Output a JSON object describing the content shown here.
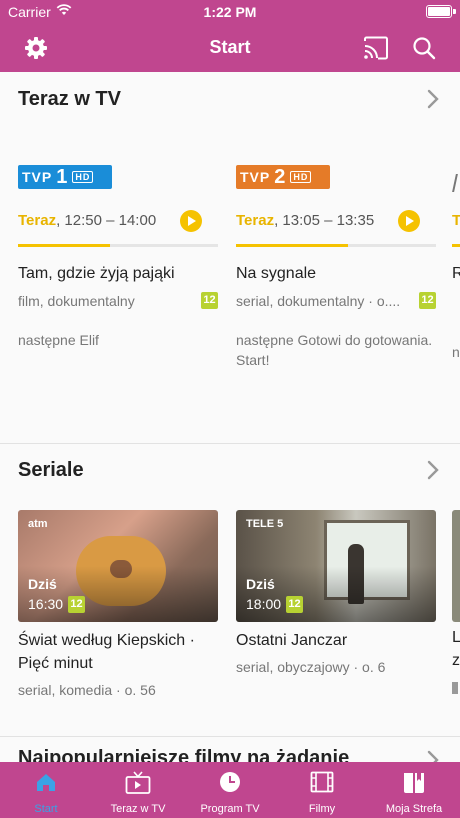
{
  "status": {
    "carrier": "Carrier",
    "time": "1:22 PM"
  },
  "header": {
    "title": "Start"
  },
  "now_on_tv": {
    "title": "Teraz w TV",
    "items": [
      {
        "channel": "TVP",
        "channel_number": "1",
        "hd": "HD",
        "now_label": "Teraz",
        "time": ", 12:50 – 14:00",
        "progress": 0.46,
        "show": "Tam, gdzie żyją pająki",
        "genre": "film, dokumentalny",
        "age": "12",
        "next": "następne Elif"
      },
      {
        "channel": "TVP",
        "channel_number": "2",
        "hd": "HD",
        "now_label": "Teraz",
        "time": ", 13:05 – 13:35",
        "progress": 0.56,
        "show": "Na sygnale",
        "genre": "serial, dokumentalny · o....",
        "age": "12",
        "next": "następne Gotowi do gotowania. Start!"
      }
    ],
    "peek": {
      "now_label": "T",
      "show": "R",
      "next": "n"
    }
  },
  "series": {
    "title": "Seriale",
    "items": [
      {
        "day": "Dziś",
        "time": "16:30",
        "age": "12",
        "title": "Świat według Kiepskich · Pięć minut",
        "meta": "serial, komedia · o. 56"
      },
      {
        "day": "Dziś",
        "time": "18:00",
        "age": "12",
        "title": "Ostatni Janczar",
        "meta": "serial, obyczajowy · o. 6"
      }
    ],
    "peek": {
      "title_line1": "L",
      "title_line2": "z"
    }
  },
  "popular": {
    "title": "Najpopularniejsze filmy na żądanie"
  },
  "tabs": [
    {
      "label": "Start",
      "icon": "home-icon",
      "active": true
    },
    {
      "label": "Teraz w TV",
      "icon": "tv-icon",
      "active": false
    },
    {
      "label": "Program TV",
      "icon": "clock-icon",
      "active": false
    },
    {
      "label": "Filmy",
      "icon": "film-icon",
      "active": false
    },
    {
      "label": "Moja Strefa",
      "icon": "bookmark-book-icon",
      "active": false
    }
  ],
  "colors": {
    "brand": "#c0468f",
    "accent_yellow": "#f5c200",
    "active_tab": "#3aa2e6",
    "age_badge": "#b8d232"
  }
}
